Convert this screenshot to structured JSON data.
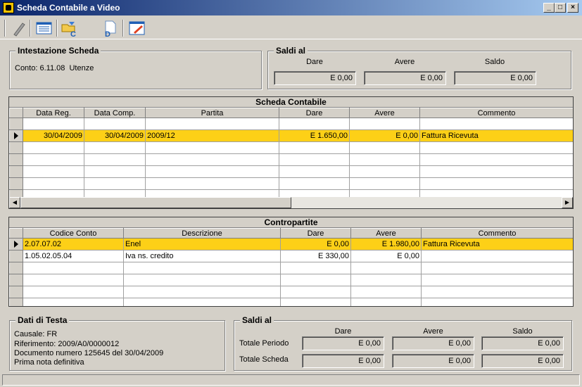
{
  "window": {
    "title": "Scheda Contabile a Video"
  },
  "toolbar": {
    "icons": [
      "tool-icon",
      "list-icon",
      "folder-c-icon",
      "document-d-icon",
      "edit-icon"
    ]
  },
  "intestazione": {
    "title": "Intestazione Scheda",
    "conto_label": "Conto: 6.11.08",
    "conto_name": "Utenze"
  },
  "saldi_top": {
    "title": "Saldi al",
    "headers": [
      "Dare",
      "Avere",
      "Saldo"
    ],
    "values": [
      "E 0,00",
      "E 0,00",
      "E 0,00"
    ]
  },
  "scheda": {
    "caption": "Scheda Contabile",
    "columns": [
      "Data Reg.",
      "Data Comp.",
      "Partita",
      "Dare",
      "Avere",
      "Commento"
    ],
    "rows": [
      [
        "",
        "",
        "",
        "",
        "",
        ""
      ],
      [
        "30/04/2009",
        "30/04/2009",
        "2009/12",
        "E 1.650,00",
        "E 0,00",
        "Fattura Ricevuta"
      ]
    ]
  },
  "contropartite": {
    "caption": "Contropartite",
    "columns": [
      "Codice Conto",
      "Descrizione",
      "Dare",
      "Avere",
      "Commento"
    ],
    "rows": [
      [
        "2.07.07.02",
        "Enel",
        "E 0,00",
        "E 1.980,00",
        "Fattura Ricevuta"
      ],
      [
        "1.05.02.05.04",
        "Iva ns. credito",
        "E 330,00",
        "E 0,00",
        ""
      ]
    ]
  },
  "dati_testa": {
    "title": "Dati di Testa",
    "lines": [
      "Causale: FR",
      "Riferimento: 2009/A0/0000012",
      "Documento numero 125645 del 30/04/2009",
      "Prima nota definitiva"
    ]
  },
  "saldi_bottom": {
    "title": "Saldi al",
    "headers": [
      "Dare",
      "Avere",
      "Saldo"
    ],
    "row_labels": [
      "Totale Periodo",
      "Totale Scheda"
    ],
    "periodo": [
      "E 0,00",
      "E 0,00",
      "E 0,00"
    ],
    "scheda": [
      "E 0,00",
      "E 0,00",
      "E 0,00"
    ]
  }
}
